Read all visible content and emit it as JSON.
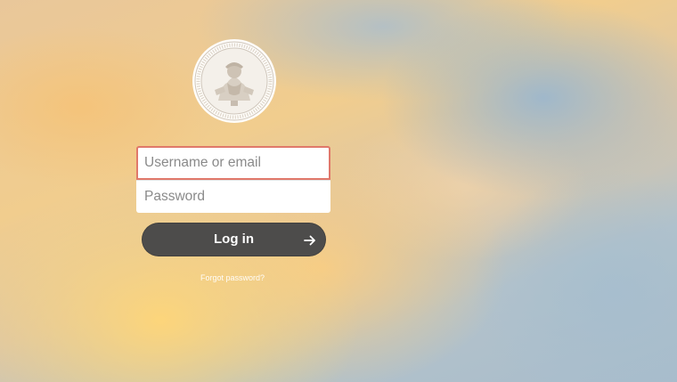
{
  "login": {
    "username_placeholder": "Username or email",
    "username_value": "",
    "password_placeholder": "Password",
    "password_value": "",
    "submit_label": "Log in",
    "forgot_link": "Forgot password?"
  },
  "icons": {
    "logo": "university-seal-logo",
    "submit": "arrow-right-icon"
  },
  "colors": {
    "button_bg": "#4d4c4b",
    "focus_border": "#e0786a",
    "field_bg": "#ffffff"
  }
}
